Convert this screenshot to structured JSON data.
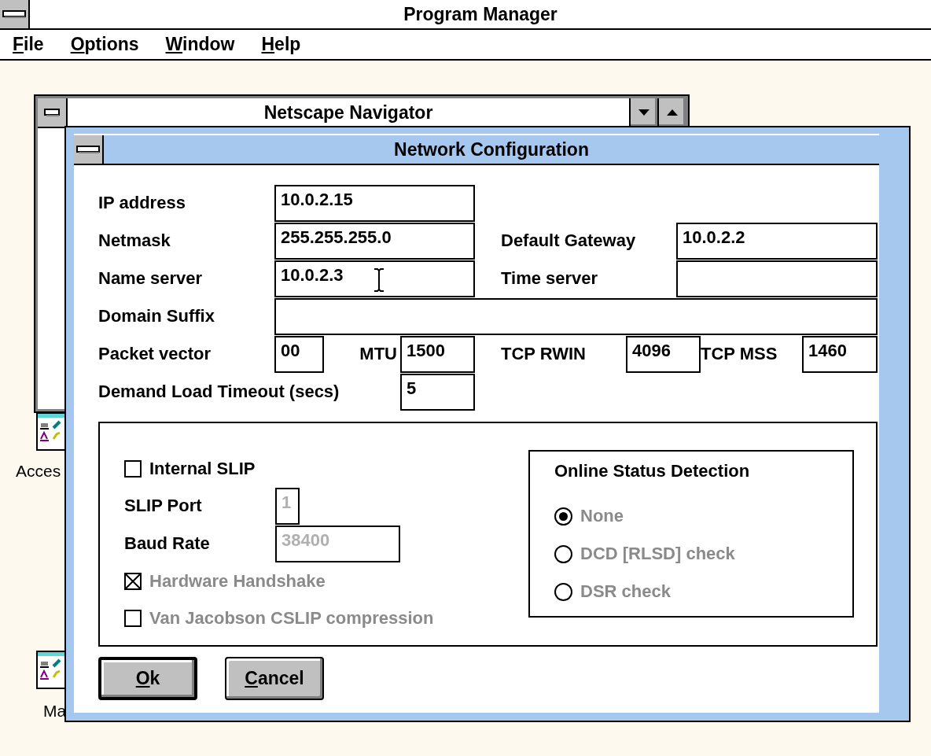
{
  "window": {
    "title": "Program Manager"
  },
  "menu": [
    {
      "label": "File",
      "underline_first": true
    },
    {
      "label": "Options",
      "underline_first": true
    },
    {
      "label": "Window",
      "underline_first": true
    },
    {
      "label": "Help",
      "underline_first": true
    }
  ],
  "netscape_window": {
    "title": "Netscape Navigator"
  },
  "group_icons": [
    {
      "label": "Acces"
    },
    {
      "label": "Ma"
    }
  ],
  "dialog": {
    "title": "Network Configuration",
    "ip_address": {
      "label": "IP address",
      "value": "10.0.2.15"
    },
    "netmask": {
      "label": "Netmask",
      "value": "255.255.255.0"
    },
    "default_gateway": {
      "label": "Default Gateway",
      "value": "10.0.2.2"
    },
    "name_server": {
      "label": "Name server",
      "value": "10.0.2.3"
    },
    "time_server": {
      "label": "Time server"
    },
    "domain_suffix": {
      "label": "Domain Suffix"
    },
    "packet_vector": {
      "label": "Packet vector",
      "value": "00"
    },
    "mtu": {
      "label": "MTU",
      "value": "1500"
    },
    "tcp_rwin": {
      "label": "TCP RWIN",
      "value": "4096"
    },
    "tcp_mss": {
      "label": "TCP MSS",
      "value": "1460"
    },
    "demand_load_timeout": {
      "label": "Demand Load Timeout (secs)",
      "value": "5"
    },
    "slip": {
      "internal_slip": {
        "label": "Internal SLIP",
        "checked": false,
        "disabled": false
      },
      "slip_port": {
        "label": "SLIP Port",
        "value": "1",
        "disabled": true
      },
      "baud_rate": {
        "label": "Baud Rate",
        "value": "38400",
        "disabled": true
      },
      "hardware_handshake": {
        "label": "Hardware Handshake",
        "checked": true,
        "disabled": true
      },
      "van_jacobson": {
        "label": "Van Jacobson CSLIP compression",
        "checked": false,
        "disabled": true
      }
    },
    "online_status": {
      "title": "Online Status Detection",
      "options": [
        {
          "label": "None",
          "selected": true,
          "disabled": true
        },
        {
          "label": "DCD [RLSD] check",
          "selected": false,
          "disabled": true
        },
        {
          "label": "DSR check",
          "selected": false,
          "disabled": true
        }
      ]
    },
    "buttons": [
      {
        "label": "Ok",
        "default": true,
        "underline_first": true
      },
      {
        "label": "Cancel",
        "default": false,
        "underline_first": true
      }
    ]
  }
}
